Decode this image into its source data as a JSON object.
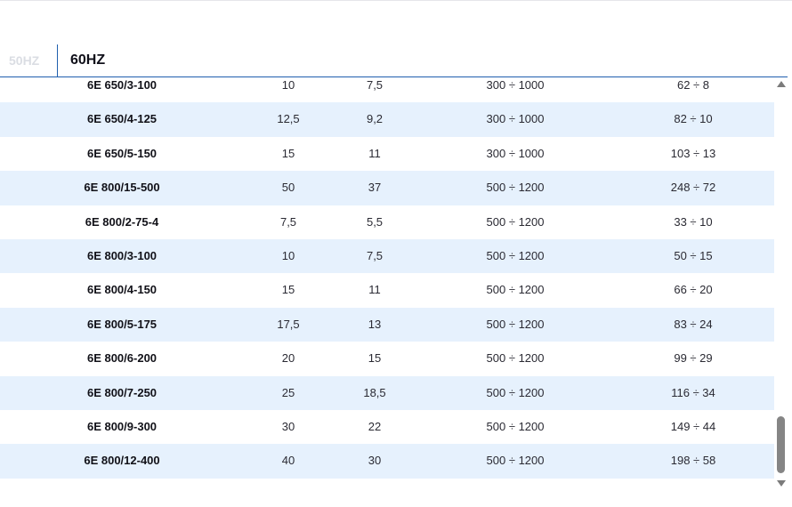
{
  "tabs": {
    "hz50_label": "50HZ",
    "hz60_label": "60HZ",
    "active": "60HZ"
  },
  "table": {
    "rows": [
      {
        "model": "6E 650/3-100",
        "kw": "10",
        "hp": "7,5",
        "range": "300 ÷ 1000",
        "flow": "62 ÷ 8"
      },
      {
        "model": "6E 650/4-125",
        "kw": "12,5",
        "hp": "9,2",
        "range": "300 ÷ 1000",
        "flow": "82 ÷ 10"
      },
      {
        "model": "6E 650/5-150",
        "kw": "15",
        "hp": "11",
        "range": "300 ÷ 1000",
        "flow": "103 ÷ 13"
      },
      {
        "model": "6E 800/15-500",
        "kw": "50",
        "hp": "37",
        "range": "500 ÷ 1200",
        "flow": "248 ÷ 72"
      },
      {
        "model": "6E 800/2-75-4",
        "kw": "7,5",
        "hp": "5,5",
        "range": "500 ÷ 1200",
        "flow": "33 ÷ 10"
      },
      {
        "model": "6E 800/3-100",
        "kw": "10",
        "hp": "7,5",
        "range": "500 ÷ 1200",
        "flow": "50 ÷ 15"
      },
      {
        "model": "6E 800/4-150",
        "kw": "15",
        "hp": "11",
        "range": "500 ÷ 1200",
        "flow": "66 ÷ 20"
      },
      {
        "model": "6E 800/5-175",
        "kw": "17,5",
        "hp": "13",
        "range": "500 ÷ 1200",
        "flow": "83 ÷ 24"
      },
      {
        "model": "6E 800/6-200",
        "kw": "20",
        "hp": "15",
        "range": "500 ÷ 1200",
        "flow": "99 ÷ 29"
      },
      {
        "model": "6E 800/7-250",
        "kw": "25",
        "hp": "18,5",
        "range": "500 ÷ 1200",
        "flow": "116 ÷ 34"
      },
      {
        "model": "6E 800/9-300",
        "kw": "30",
        "hp": "22",
        "range": "500 ÷ 1200",
        "flow": "149 ÷ 44"
      },
      {
        "model": "6E 800/12-400",
        "kw": "40",
        "hp": "30",
        "range": "500 ÷ 1200",
        "flow": "198 ÷ 58"
      }
    ]
  },
  "colors": {
    "accent": "#1f5fae",
    "row_alt": "#e6f1fd",
    "inactive_tab": "#dadde3",
    "scroll_thumb": "#858585"
  },
  "icons": {
    "scroll_up": "scroll-up-arrow-icon",
    "scroll_down": "scroll-down-arrow-icon"
  }
}
